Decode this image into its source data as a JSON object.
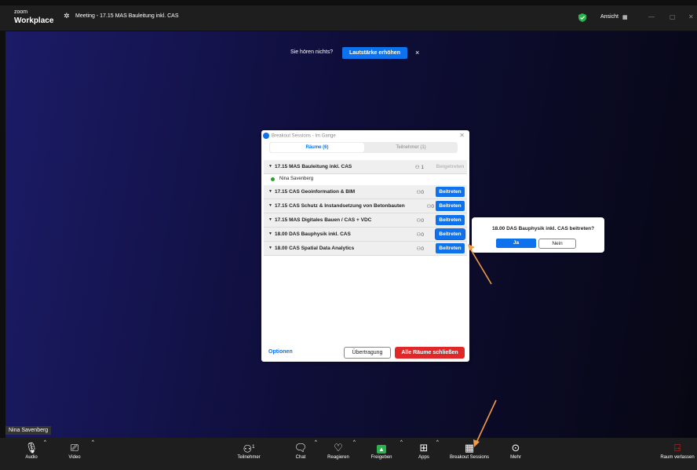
{
  "titlebar": {
    "logo_small": "zoom",
    "logo_big": "Workplace",
    "meeting_title": "Meeting - 17.15 MAS Bauleitung inkl. CAS",
    "view_label": "Ansicht",
    "icons": [
      "meeting-icon",
      "shield-check-icon",
      "grid-icon",
      "minimize-icon",
      "maximize-icon",
      "close-icon"
    ]
  },
  "notice": {
    "text": "Sie hören nichts?",
    "button": "Lautstärke erhöhen",
    "close": "×"
  },
  "participant_name": "Nina Savenberg",
  "dialog": {
    "title": "Breakout Sessions - Im Gange",
    "tabs": [
      "Räume (6)",
      "Teilnehmer (1)"
    ],
    "rooms": [
      {
        "name": "17.15 MAS Bauleitung inkl. CAS",
        "count": "1",
        "action": "Beigetreten",
        "joined": true
      },
      {
        "name": "17.15 CAS Geoinformation & BIM",
        "count": "0",
        "action": "Beitreten"
      },
      {
        "name": "17.15 CAS Schutz & Instandsetzung von Betonbauten",
        "count": "0",
        "action": "Beitreten"
      },
      {
        "name": "17.15 MAS Digitales Bauen / CAS + VDC",
        "count": "0",
        "action": "Beitreten"
      },
      {
        "name": "18.00 DAS Bauphysik inkl. CAS",
        "count": "0",
        "action": "Beitreten"
      },
      {
        "name": "18.00 CAS Spatial Data Analytics",
        "count": "0",
        "action": "Beitreten"
      }
    ],
    "member": "Nina Savenberg",
    "options": "Optionen",
    "broadcast": "Übertragung",
    "close_all": "Alle Räume schließen"
  },
  "popup": {
    "question": "18.00 DAS Bauphysik inkl. CAS beitreten?",
    "yes": "Ja",
    "no": "Nein"
  },
  "toolbar": {
    "audio": "Audio",
    "video": "Video",
    "participants": "Teilnehmer",
    "participants_count": "1",
    "chat": "Chat",
    "react": "Reagieren",
    "share": "Freigeben",
    "apps": "Apps",
    "breakout": "Breakout Sessions",
    "more": "Mehr",
    "leave": "Raum verlassen"
  },
  "colors": {
    "accent": "#0e72ed",
    "danger": "#e02828",
    "annotation_arrow": "#f39c44"
  }
}
